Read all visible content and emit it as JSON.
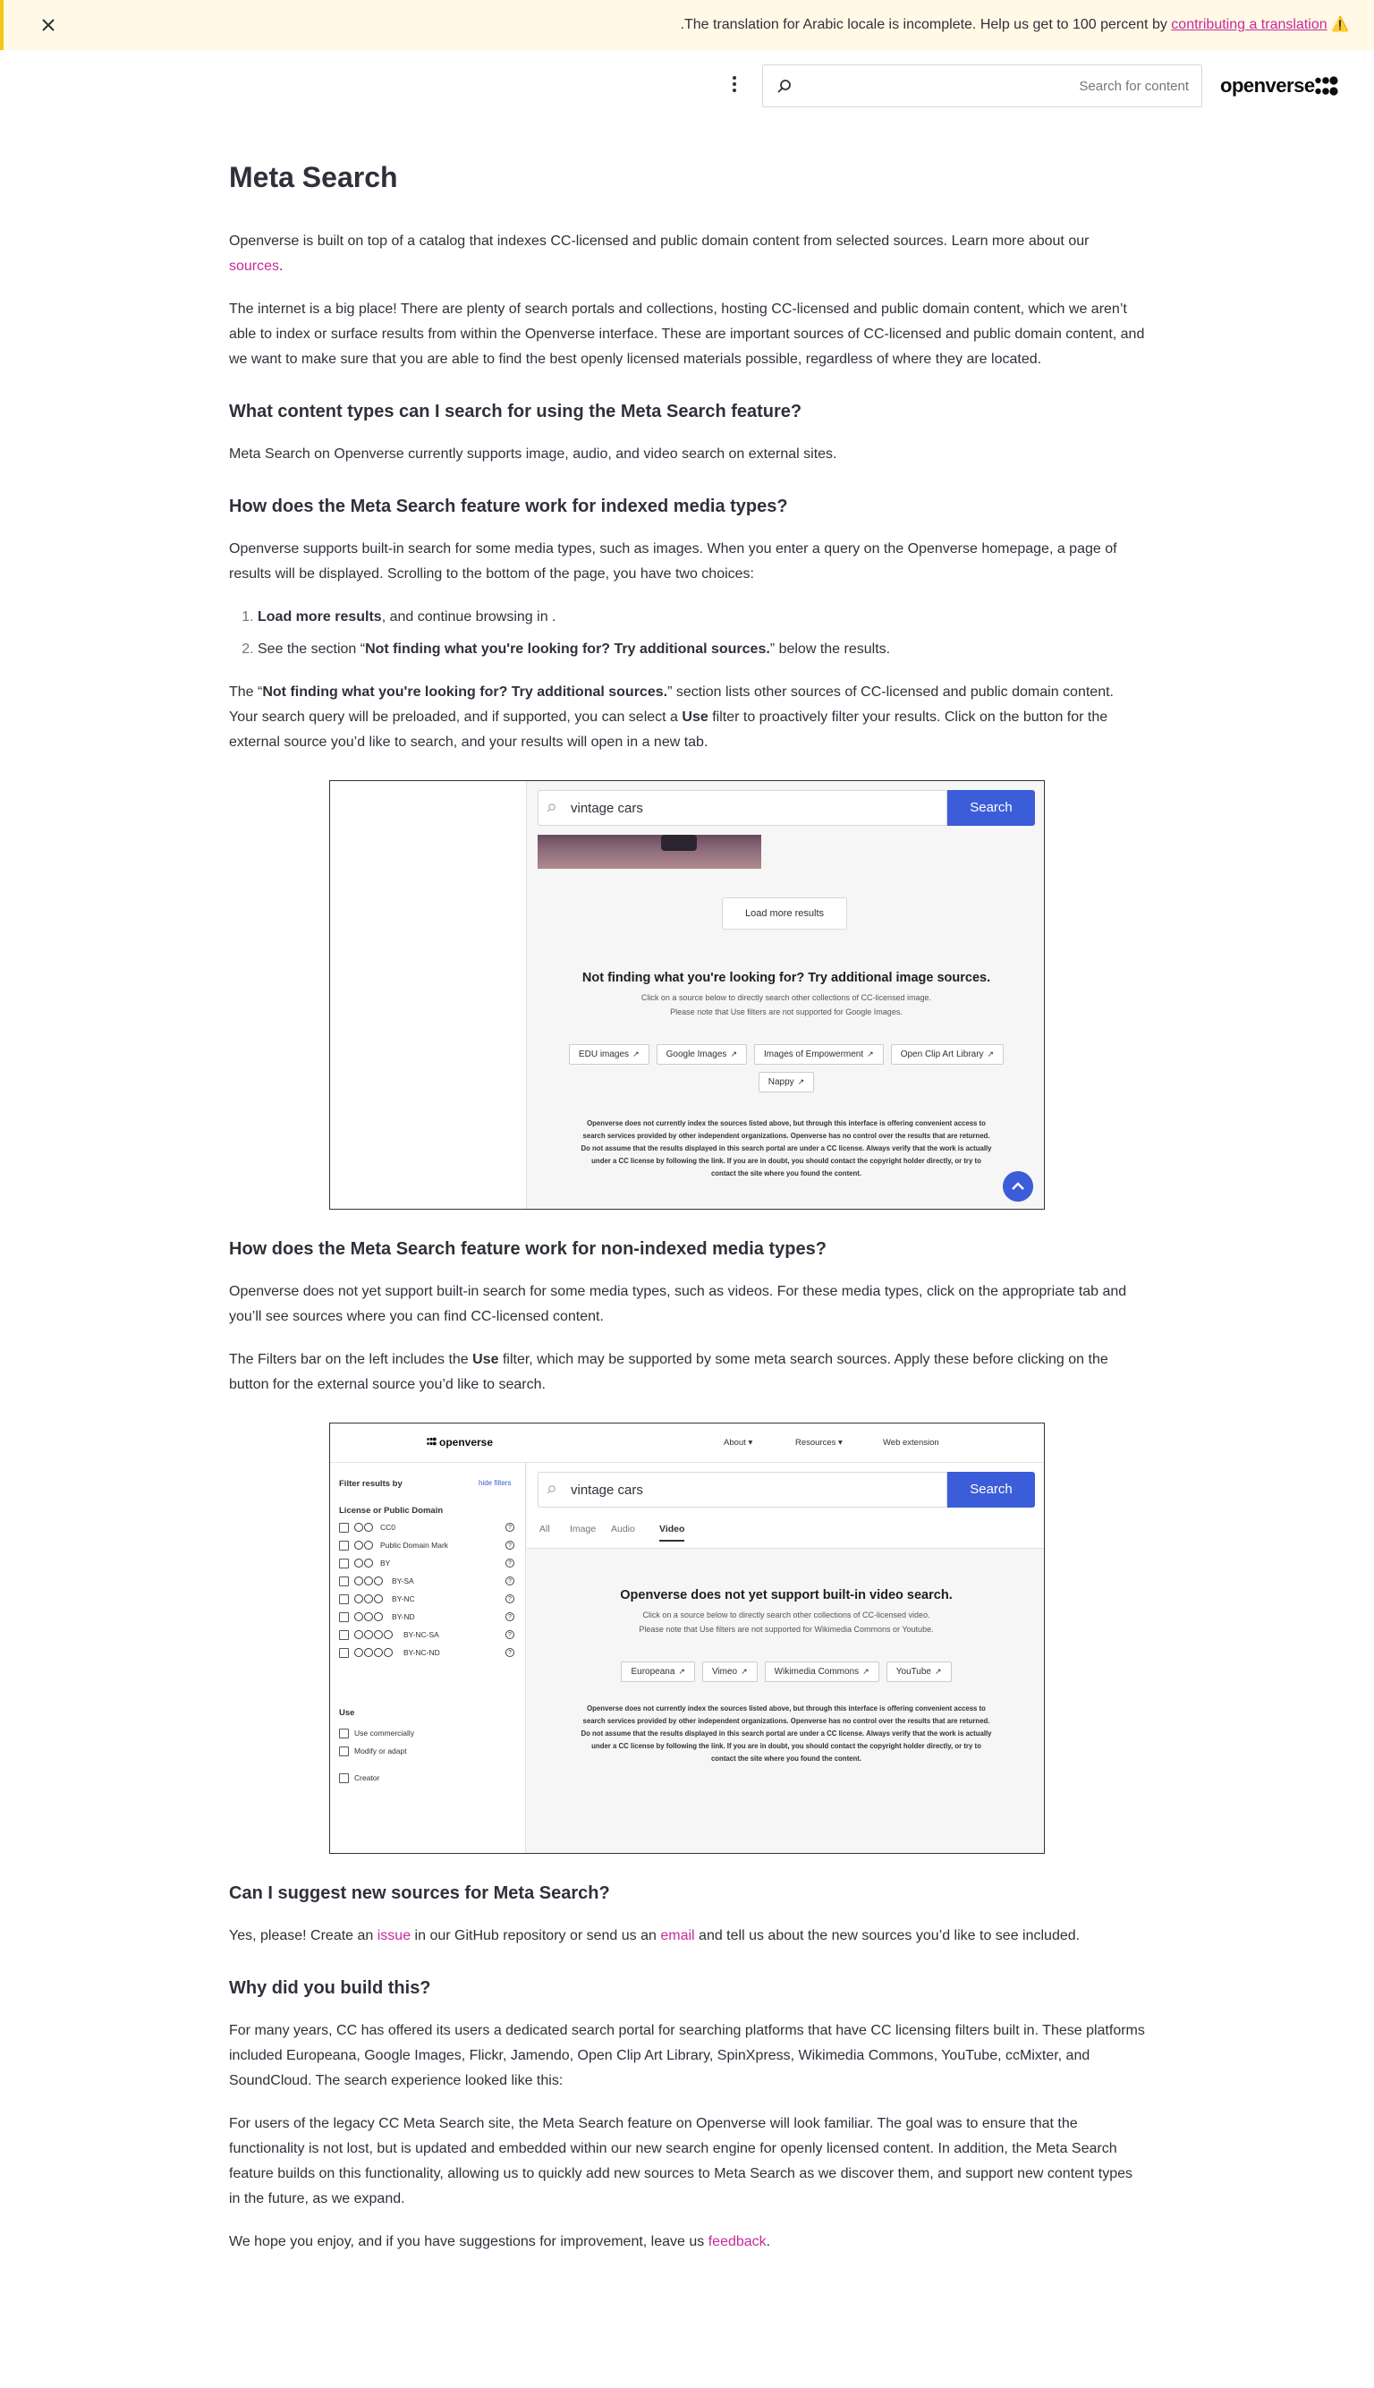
{
  "banner": {
    "text_before": ".The translation for Arabic locale is incomplete. Help us get to 100 percent by ",
    "link_text": "contributing a translation",
    "warning_glyph": "⚠️",
    "accent_color": "#f5c518",
    "background_color": "#fff9e6"
  },
  "header": {
    "search_placeholder": "Search for content",
    "brand_name": "openverse",
    "menu_icon": "kebab-menu-icon",
    "search_icon": "search-icon"
  },
  "page": {
    "title": "Meta Search",
    "intro_p1_text": "Openverse is built on top of a catalog that indexes CC-licensed and public domain content from selected sources. Learn more about our ",
    "intro_p1_link": "sources",
    "intro_p1_end": ".",
    "intro_p2": "The internet is a big place! There are plenty of search portals and collections, hosting CC-licensed and public domain content, which we aren’t able to index or surface results from within the Openverse interface. These are important sources of CC-licensed and public domain content, and we want to make sure that you are able to find the best openly licensed materials possible, regardless of where they are located.",
    "h_content_types": "What content types can I search for using the Meta Search feature?",
    "p_content_types": "Meta Search on Openverse currently supports image, audio, and video search on external sites.",
    "h_indexed": "How does the Meta Search feature work for indexed media types?",
    "p_indexed": "Openverse supports built-in search for some media types, such as images. When you enter a query on the Openverse homepage, a page of results will be displayed. Scrolling to the bottom of the page, you have two choices:",
    "list": [
      {
        "bold": "Load more results",
        "rest": ", and continue browsing in ."
      },
      {
        "pre": "See the section “",
        "bold": "Not finding what you're looking for? Try additional sources.",
        "rest": "” below the results."
      }
    ],
    "p_section_pre": "The “",
    "p_section_bold": "Not finding what you're looking for? Try additional sources.",
    "p_section_mid": "” section lists other sources of CC-licensed and public domain content. Your search query will be preloaded, and if supported, you can select a ",
    "p_section_use": "Use",
    "p_section_end": " filter to proactively filter your results. Click on the button for the external source you’d like to search, and your results will open in a new tab.",
    "h_nonindexed": "How does the Meta Search feature work for non-indexed media types?",
    "p_nonindexed1": "Openverse does not yet support built-in search for some media types, such as videos. For these media types, click on the appropriate tab and you’ll see sources where you can find CC-licensed content.",
    "p_nonindexed2_pre": "The Filters bar on the left includes the ",
    "p_nonindexed2_use": "Use",
    "p_nonindexed2_end": " filter, which may be supported by some meta search sources. Apply these before clicking on the button for the external source you’d like to search.",
    "h_suggest": "Can I suggest new sources for Meta Search?",
    "p_suggest_1": "Yes, please! Create an ",
    "p_suggest_issue": "issue",
    "p_suggest_2": " in our GitHub repository or send us an ",
    "p_suggest_email": "email",
    "p_suggest_3": " and tell us about the new sources you’d like to see included.",
    "h_why": "Why did you build this?",
    "p_why1": "For many years, CC has offered its users a dedicated search portal for searching platforms that have CC licensing filters built in. These platforms included Europeana, Google Images, Flickr, Jamendo, Open Clip Art Library, SpinXpress, Wikimedia Commons, YouTube, ccMixter, and SoundCloud. The search experience looked like this:",
    "p_why2": "For users of the legacy CC Meta Search site, the Meta Search feature on Openverse will look familiar. The goal was to ensure that the functionality is not lost, but is updated and embedded within our new search engine for openly licensed content. In addition, the Meta Search feature builds on this functionality, allowing us to quickly add new sources to Meta Search as we discover them, and support new content types in the future, as we expand.",
    "p_feedback_1": "We hope you enjoy, and if you have suggestions for improvement, leave us ",
    "p_feedback_link": "feedback",
    "p_feedback_2": "."
  },
  "shot1": {
    "query": "vintage cars",
    "search_button": "Search",
    "load_more": "Load more results",
    "title": "Not finding what you're looking for? Try additional image sources.",
    "sub1": "Click on a source below to directly search other collections of CC-licensed image.",
    "sub2": "Please note that Use filters are not supported for Google Images.",
    "sources": [
      "EDU images",
      "Google Images",
      "Images of Empowerment",
      "Open Clip Art Library",
      "Nappy"
    ],
    "disclaimer1": "Openverse does not currently index the sources listed above, but through this interface is offering convenient access to",
    "disclaimer2": "search services provided by other independent organizations. Openverse has no control over the results that are returned.",
    "disclaimer3": "Do not assume that the results displayed in this search portal are under a CC license. Always verify that the work is actually",
    "disclaimer4": "under a CC license by following the link. If you are in doubt, you should contact the copyright holder directly, or try to",
    "disclaimer5": "contact the site where you found the content.",
    "accent_color": "#3c5dd9"
  },
  "shot2": {
    "logo": "openverse",
    "nav": [
      "About ▾",
      "Resources ▾",
      "Web extension"
    ],
    "filter_header": "Filter results by",
    "hide_filters": "hide filters",
    "license_group": "License or Public Domain",
    "licenses": [
      {
        "label": "CC0",
        "icons": 2
      },
      {
        "label": "Public Domain Mark",
        "icons": 2
      },
      {
        "label": "BY",
        "icons": 2
      },
      {
        "label": "BY-SA",
        "icons": 3
      },
      {
        "label": "BY-NC",
        "icons": 3
      },
      {
        "label": "BY-ND",
        "icons": 3
      },
      {
        "label": "BY-NC-SA",
        "icons": 4
      },
      {
        "label": "BY-NC-ND",
        "icons": 4
      }
    ],
    "use_group": "Use",
    "use_options": [
      "Use commercially",
      "Modify or adapt"
    ],
    "creator": "Creator",
    "query": "vintage cars",
    "search_button": "Search",
    "tabs": [
      "All",
      "Image",
      "Audio",
      "Video"
    ],
    "active_tab": "Video",
    "title": "Openverse does not yet support built-in video search.",
    "sub1": "Click on a source below to directly search other collections of CC-licensed video.",
    "sub2": "Please note that Use filters are not supported for Wikimedia Commons or Youtube.",
    "sources": [
      "Europeana",
      "Vimeo",
      "Wikimedia Commons",
      "YouTube"
    ],
    "disclaimer1": "Openverse does not currently index the sources listed above, but through this interface is offering convenient access to",
    "disclaimer2": "search services provided by other independent organizations. Openverse has no control over the results that are returned.",
    "disclaimer3": "Do not assume that the results displayed in this search portal are under a CC license. Always verify that the work is actually",
    "disclaimer4": "under a CC license by following the link. If you are in doubt, you should contact the copyright holder directly, or try to",
    "disclaimer5": "contact the site where you found the content."
  },
  "colors": {
    "link": "#c52b9b",
    "text": "#30303a",
    "button_blue": "#3c5dd9"
  }
}
